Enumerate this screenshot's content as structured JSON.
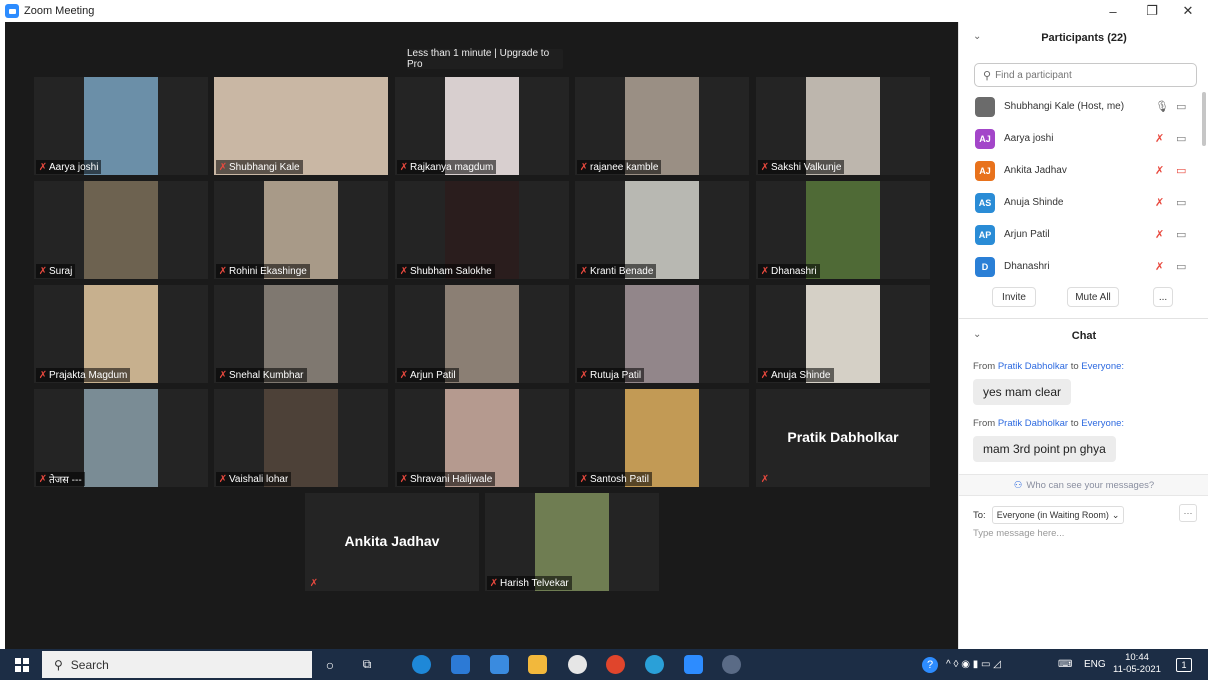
{
  "window": {
    "title": "Zoom Meeting",
    "minimize": "–",
    "maximize": "❐",
    "close": "✕"
  },
  "banner": "Less than 1 minute | Upgrade to Pro",
  "tiles": [
    {
      "name": "Aarya joshi",
      "photo": "#6b8fa8"
    },
    {
      "name": "Shubhangi Kale",
      "photo": "#c9b7a4",
      "speaking": true
    },
    {
      "name": "Rajkanya magdum",
      "photo": "#d8cfcf"
    },
    {
      "name": "rajanee kamble",
      "photo": "#9a8f84"
    },
    {
      "name": "Sakshi Valkunje",
      "photo": "#bdb6ad"
    },
    {
      "name": "Suraj",
      "photo": "#6d6250"
    },
    {
      "name": "Rohini  Ekashinge",
      "photo": "#a89a88"
    },
    {
      "name": "Shubham Salokhe",
      "photo": "#2a1d1d"
    },
    {
      "name": "Kranti Benade",
      "photo": "#b8b8b2"
    },
    {
      "name": "Dhanashri",
      "photo": "#4f6a36"
    },
    {
      "name": "Prajakta Magdum",
      "photo": "#c7b08e"
    },
    {
      "name": "Snehal Kumbhar",
      "photo": "#7f7870"
    },
    {
      "name": "Arjun Patil",
      "photo": "#8b7f74"
    },
    {
      "name": "Rutuja Patil",
      "photo": "#92868a"
    },
    {
      "name": "Anuja Shinde",
      "photo": "#d5d0c6"
    },
    {
      "name": "तेजस ---",
      "photo": "#7a8c95"
    },
    {
      "name": "Vaishali lohar",
      "photo": "#4d4138"
    },
    {
      "name": "Shravani Halijwale",
      "photo": "#b59a8f"
    },
    {
      "name": "Santosh Patil",
      "photo": "#c29a55"
    },
    {
      "name": "",
      "bigname": "Pratik Dabholkar"
    },
    {
      "name": "",
      "bigname": "Ankita Jadhav"
    },
    {
      "name": "Harish Telvekar",
      "photo": "#6f7d52"
    }
  ],
  "participants": {
    "header": "Participants (22)",
    "search_placeholder": "Find a participant",
    "list": [
      {
        "name": "Shubhangi Kale (Host, me)",
        "initials": "",
        "color": "#6b6b6b",
        "mic": "on",
        "cam": "on"
      },
      {
        "name": "Aarya joshi",
        "initials": "AJ",
        "color": "#a346c9",
        "mic": "off",
        "cam": "on"
      },
      {
        "name": "Ankita Jadhav",
        "initials": "AJ",
        "color": "#e8721c",
        "mic": "off",
        "cam": "off"
      },
      {
        "name": "Anuja Shinde",
        "initials": "AS",
        "color": "#2a8cd6",
        "mic": "off",
        "cam": "on"
      },
      {
        "name": "Arjun Patil",
        "initials": "AP",
        "color": "#2a8cd6",
        "mic": "off",
        "cam": "on"
      },
      {
        "name": "Dhanashri",
        "initials": "D",
        "color": "#2a7fd6",
        "mic": "off",
        "cam": "on"
      }
    ],
    "invite": "Invite",
    "mute_all": "Mute All",
    "more": "..."
  },
  "chat": {
    "header": "Chat",
    "messages": [
      {
        "from_prefix": "From",
        "sender": "Pratik Dabholkar",
        "to_word": "to",
        "recipient": "Everyone:",
        "text": "yes mam clear"
      },
      {
        "from_prefix": "From",
        "sender": "Pratik Dabholkar",
        "to_word": "to",
        "recipient": "Everyone:",
        "text": "mam 3rd point pn ghya"
      }
    ],
    "who_can_see": "Who can see your messages?",
    "to_label": "To:",
    "to_value": "Everyone (in Waiting Room)",
    "more": "···",
    "placeholder": "Type message here..."
  },
  "taskbar": {
    "search": "Search",
    "lang": "ENG",
    "time": "10:44",
    "date": "11-05-2021",
    "notif": "1"
  }
}
